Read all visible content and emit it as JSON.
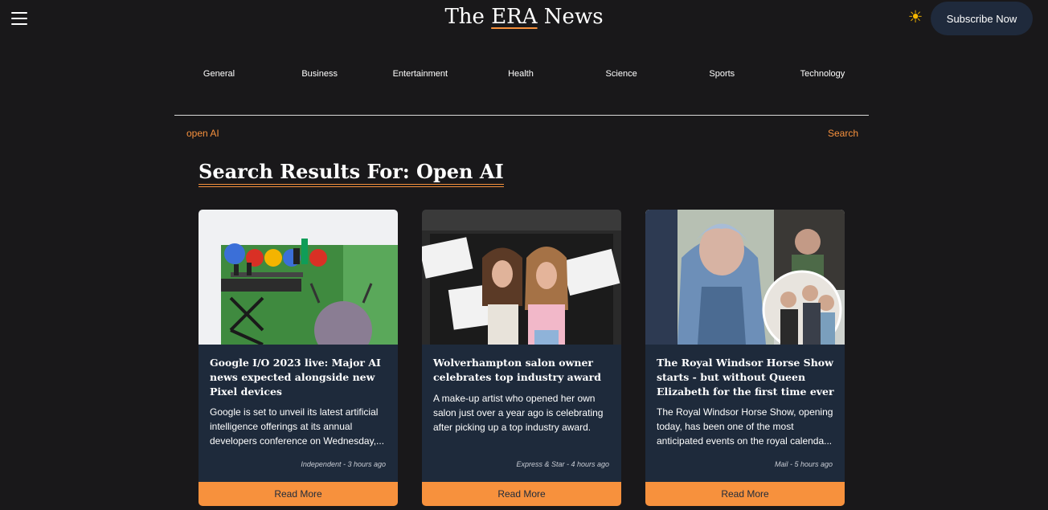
{
  "header": {
    "brand_prefix": "The ",
    "brand_accent": "ERA",
    "brand_suffix": " News",
    "theme_icon": "sun-icon",
    "subscribe_label": "Subscribe Now"
  },
  "categories": [
    "General",
    "Business",
    "Entertainment",
    "Health",
    "Science",
    "Sports",
    "Technology"
  ],
  "search": {
    "value": "open AI",
    "link_label": "Search"
  },
  "results_title": "Search Results For: Open AI",
  "colors": {
    "background": "#19181a",
    "accent": "#f7913d",
    "card": "#1e2a3b",
    "subscribe_bg": "#1f2a3c"
  },
  "articles": [
    {
      "title": "Google I/O 2023 live: Major AI news expected alongside new Pixel devices",
      "description": "Google is set to unveil its latest artificial intelligence offerings at its annual developers conference on Wednesday,...",
      "source": "Independent - 3 hours ago",
      "read_more": "Read More"
    },
    {
      "title": "Wolverhampton salon owner celebrates top industry award",
      "description": "A make-up artist who opened her own salon just over a year ago is celebrating after picking up a top industry award.",
      "source": "Express & Star - 4 hours ago",
      "read_more": "Read More"
    },
    {
      "title": "The Royal Windsor Horse Show starts - but without Queen Elizabeth for the first time ever",
      "description": "The Royal Windsor Horse Show, opening today, has been one of the most anticipated events on the royal calenda...",
      "source": "Mail - 5 hours ago",
      "read_more": "Read More"
    }
  ]
}
